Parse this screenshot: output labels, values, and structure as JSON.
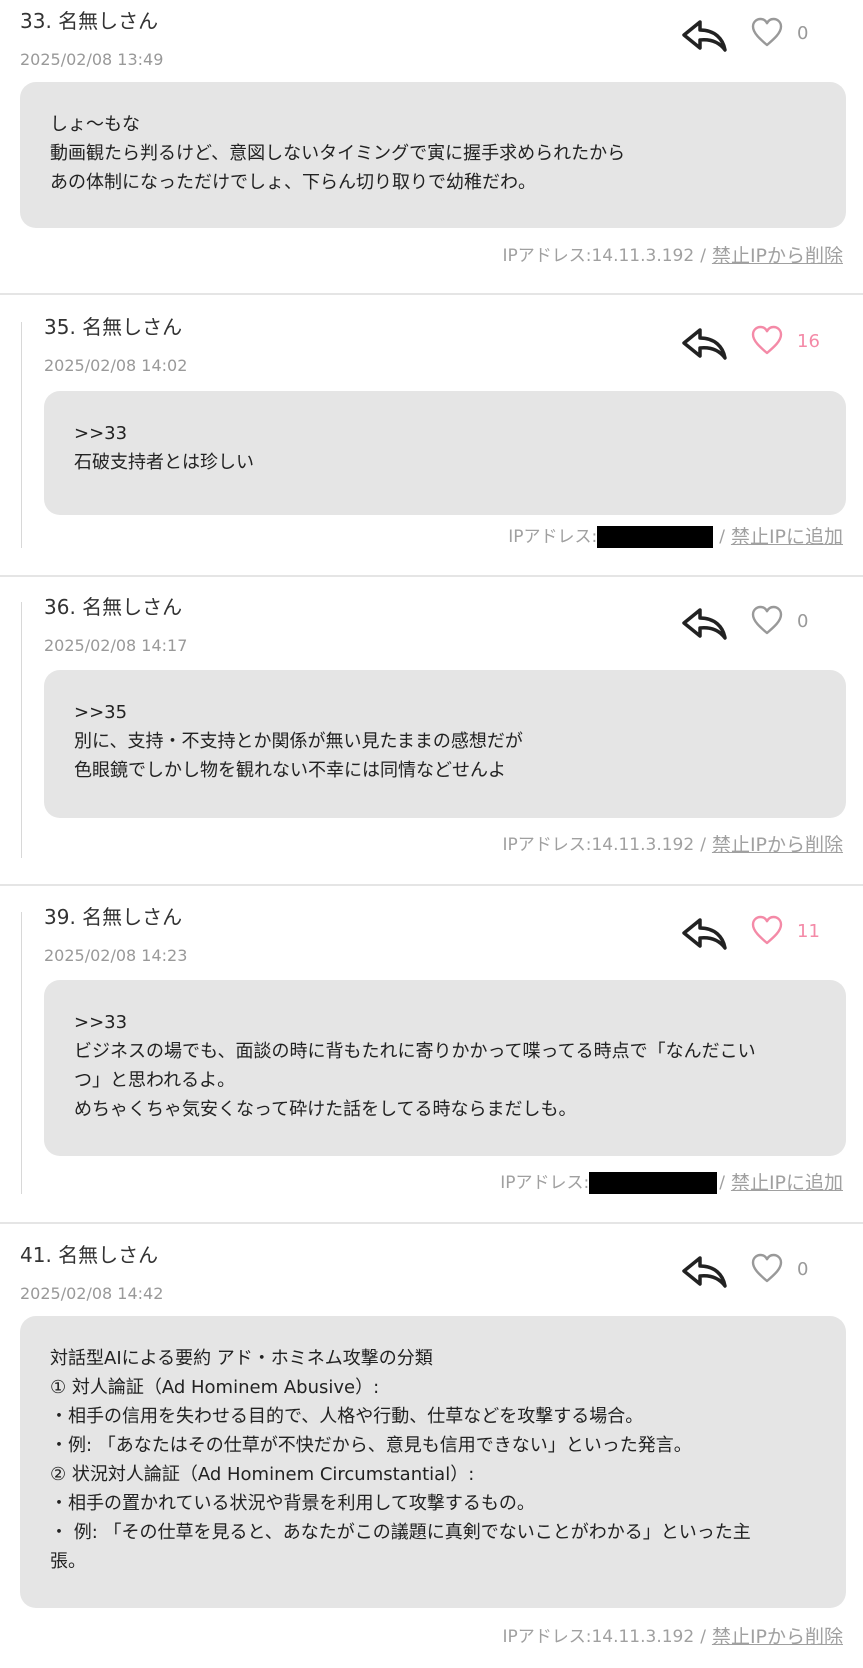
{
  "posts": [
    {
      "number": "33.",
      "author": "名無しさん",
      "date": "2025/02/08 13:49",
      "likes": "0",
      "liked": false,
      "lines": [
        "しょ～もな",
        "動画観たら判るけど、意図しないタイミングで寅に握手求められたから",
        "あの体制になっただけでしょ、下らん切り取りで幼稚だわ。"
      ],
      "ip_label": "IPアドレス:",
      "ip": "14.11.3.192",
      "separator": "/",
      "action": "禁止IPから削除"
    },
    {
      "number": "35.",
      "author": "名無しさん",
      "date": "2025/02/08 14:02",
      "likes": "16",
      "liked": true,
      "lines": [
        ">>33",
        "石破支持者とは珍しい"
      ],
      "ip_label": "IPアドレス:",
      "ip": "",
      "separator": "/",
      "action": "禁止IPに追加"
    },
    {
      "number": "36.",
      "author": "名無しさん",
      "date": "2025/02/08 14:17",
      "likes": "0",
      "liked": false,
      "lines": [
        ">>35",
        "別に、支持・不支持とか関係が無い見たままの感想だが",
        "色眼鏡でしかし物を観れない不幸には同情などせんよ"
      ],
      "ip_label": "IPアドレス:",
      "ip": "14.11.3.192",
      "separator": "/",
      "action": "禁止IPから削除"
    },
    {
      "number": "39.",
      "author": "名無しさん",
      "date": "2025/02/08 14:23",
      "likes": "11",
      "liked": true,
      "lines": [
        ">>33",
        "ビジネスの場でも、面談の時に背もたれに寄りかかって喋ってる時点で「なんだこい",
        "つ」と思われるよ。",
        "めちゃくちゃ気安くなって砕けた話をしてる時ならまだしも。"
      ],
      "ip_label": "IPアドレス:",
      "ip": "",
      "separator": "/",
      "action": "禁止IPに追加"
    },
    {
      "number": "41.",
      "author": "名無しさん",
      "date": "2025/02/08 14:42",
      "likes": "0",
      "liked": false,
      "lines": [
        "対話型AIによる要約 アド・ホミネム攻撃の分類",
        "① 対人論証（Ad Hominem Abusive）:",
        "・相手の信用を失わせる目的で、人格や行動、仕草などを攻撃する場合。",
        "・例: 「あなたはその仕草が不快だから、意見も信用できない」といった発言。",
        "② 状況対人論証（Ad Hominem Circumstantial）:",
        "・相手の置かれている状況や背景を利用して攻撃するもの。",
        "・ 例: 「その仕草を見ると、あなたがこの議題に真剣でないことがわかる」といった主",
        "張。"
      ],
      "ip_label": "IPアドレス:",
      "ip": "14.11.3.192",
      "separator": "/",
      "action": "禁止IPから削除"
    }
  ],
  "icons": {
    "reply": "reply-arrow-icon",
    "like": "heart-icon"
  },
  "colors": {
    "bubble": "#e5e5e5",
    "meta": "#999999",
    "like_active": "#f48aa7",
    "redaction": "#000000"
  }
}
